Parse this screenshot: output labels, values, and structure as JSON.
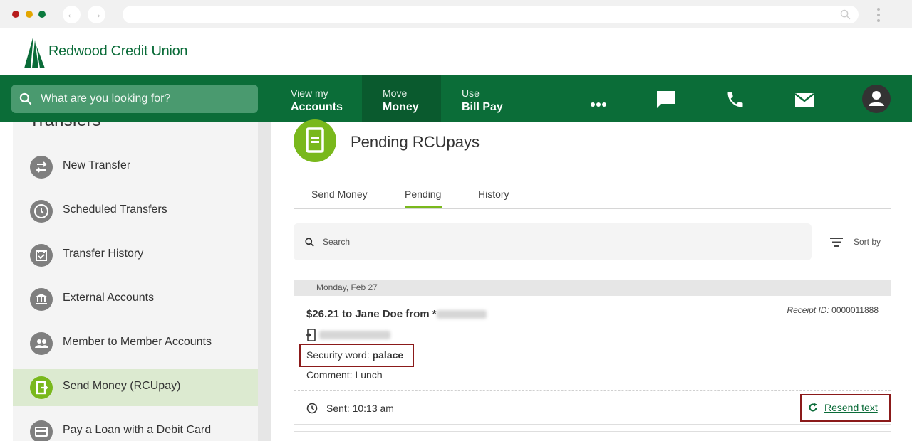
{
  "colors": {
    "brand_green": "#0b6d38",
    "accent_lime": "#79b81c",
    "highlight_red": "#8b1a1a"
  },
  "browser": {
    "icons": [
      "back-icon",
      "forward-icon",
      "search-icon",
      "kebab-icon"
    ]
  },
  "brand": {
    "name": "Redwood Credit Union",
    "icon": "redwood-tree-logo"
  },
  "nav": {
    "search_placeholder": "What are you looking for?",
    "tabs": [
      {
        "small": "View my",
        "big": "Accounts"
      },
      {
        "small": "Move",
        "big": "Money",
        "active": true
      },
      {
        "small": "Use",
        "big": "Bill Pay"
      }
    ],
    "icons": [
      "more-icon",
      "chat-icon",
      "phone-icon",
      "mail-icon",
      "profile-icon"
    ]
  },
  "sidebar": {
    "heading": "Transfers",
    "items": [
      {
        "label": "New Transfer",
        "icon": "swap-arrows-icon"
      },
      {
        "label": "Scheduled Transfers",
        "icon": "clock-icon"
      },
      {
        "label": "Transfer History",
        "icon": "calendar-check-icon"
      },
      {
        "label": "External Accounts",
        "icon": "bank-icon"
      },
      {
        "label": "Member to Member Accounts",
        "icon": "people-icon"
      },
      {
        "label": "Send Money (RCUpay)",
        "icon": "send-money-icon",
        "active": true
      },
      {
        "label": "Pay a Loan with a Debit Card",
        "icon": "credit-card-icon"
      }
    ]
  },
  "main": {
    "title": "Pending RCUpays",
    "tabs": [
      "Send Money",
      "Pending",
      "History"
    ],
    "active_tab": "Pending",
    "search_placeholder": "Search",
    "sort_label": "Sort by",
    "date_group": "Monday, Feb 27",
    "transaction": {
      "amount_text": "$26.21 to Jane Doe from *",
      "receipt_label": "Receipt ID:",
      "receipt_id": "0000011888",
      "security_label": "Security word:",
      "security_word": "palace",
      "comment": "Comment: Lunch",
      "sent": "Sent: 10:13 am",
      "resend": "Resend text"
    }
  }
}
